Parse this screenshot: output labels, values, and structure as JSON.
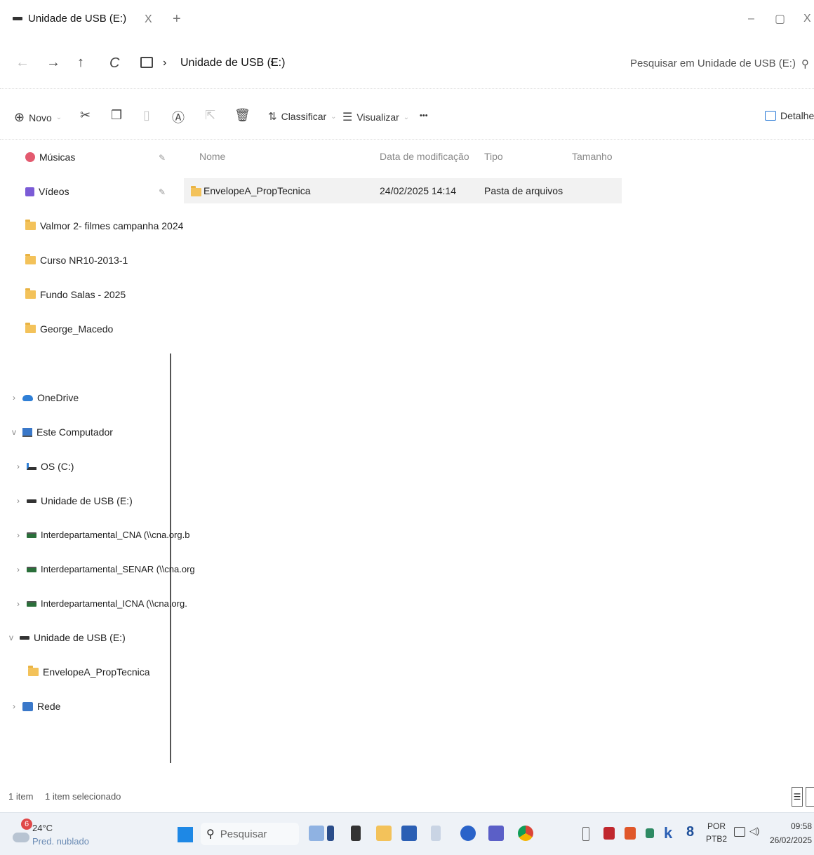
{
  "window": {
    "tab_title": "Unidade de USB (E:)",
    "tab_close": "X",
    "new_tab": "+",
    "minimize": "–",
    "maximize": "▢",
    "close": "X"
  },
  "address": {
    "back": "←",
    "forward": "→",
    "up": "↑",
    "refresh": "C",
    "separator": "›",
    "crumb": "Unidade de USB (E:)",
    "search_placeholder": "Pesquisar em Unidade de USB (E:)"
  },
  "toolbar": {
    "new_label": "Novo",
    "sort_label": "Classificar",
    "view_label": "Visualizar",
    "more_label": "•••",
    "details_label": "Detalhes"
  },
  "sidebar": {
    "quick_access": [
      {
        "label": "Músicas",
        "icon": "music-icon"
      },
      {
        "label": "Vídeos",
        "icon": "video-icon"
      },
      {
        "label": "Valmor 2- filmes campanha 2024",
        "icon": "folder-icon"
      },
      {
        "label": "Curso NR10-2013-1",
        "icon": "folder-icon"
      },
      {
        "label": "Fundo Salas  - 2025",
        "icon": "folder-icon"
      },
      {
        "label": "George_Macedo",
        "icon": "folder-icon"
      }
    ],
    "tree": [
      {
        "label": "OneDrive",
        "icon": "cloud-icon",
        "chevron": "›"
      },
      {
        "label": "Este Computador",
        "icon": "computer-icon",
        "chevron": "v"
      },
      {
        "label": "OS (C:)",
        "icon": "drive-icon",
        "chevron": "›"
      },
      {
        "label": "Unidade de USB (E:)",
        "icon": "usb-drive-icon",
        "chevron": "›"
      },
      {
        "label": "Interdepartamental_CNA (\\\\cna.org.b",
        "icon": "network-drive-icon",
        "chevron": "›"
      },
      {
        "label": "Interdepartamental_SENAR (\\\\cna.org",
        "icon": "network-drive-icon",
        "chevron": "›"
      },
      {
        "label": "Interdepartamental_ICNA (\\\\cna.org.",
        "icon": "network-drive-icon",
        "chevron": "›"
      },
      {
        "label": "Unidade de USB (E:)",
        "icon": "usb-drive-icon",
        "chevron": "v"
      },
      {
        "label": "EnvelopeA_PropTecnica",
        "icon": "folder-icon",
        "chevron": ""
      },
      {
        "label": "Rede",
        "icon": "network-icon",
        "chevron": "›"
      }
    ]
  },
  "file_list": {
    "columns": [
      "Nome",
      "Data de modificação",
      "Tipo",
      "Tamanho"
    ],
    "rows": [
      {
        "name": "EnvelopeA_PropTecnica",
        "modified": "24/02/2025 14:14",
        "type": "Pasta de arquivos",
        "size": ""
      }
    ]
  },
  "status": {
    "count": "1 item",
    "selected": "1 item selecionado"
  },
  "taskbar": {
    "weather_temp": "24°C",
    "weather_desc": "Pred. nublado",
    "weather_badge": "6",
    "search_label": "Pesquisar",
    "lang_top": "POR",
    "lang_bottom": "PTB2",
    "time": "09:58",
    "date": "26/02/2025"
  },
  "colors": {
    "folder": "#f3c25a",
    "onedrive": "#2f7fd6",
    "windows_blue": "#1e88e5"
  }
}
